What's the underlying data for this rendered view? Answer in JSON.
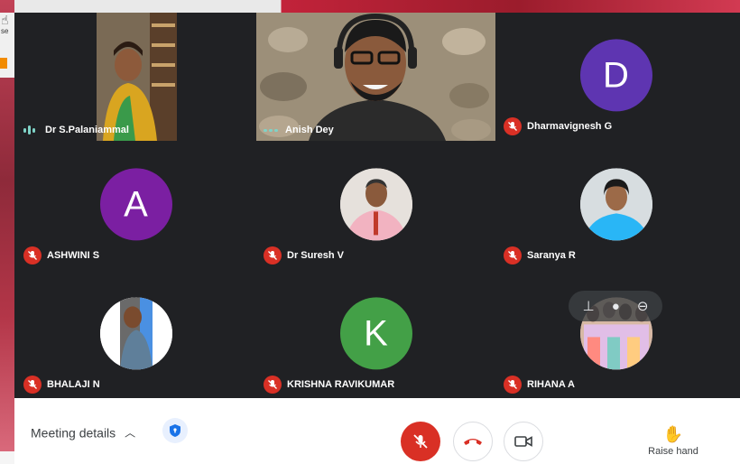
{
  "background": {
    "left_text": "se"
  },
  "participants": [
    {
      "name": "Dr S.Palaniammal",
      "state": "speaking",
      "media": "video"
    },
    {
      "name": "Anish Dey",
      "state": "speaking",
      "media": "video"
    },
    {
      "name": "Dharmavignesh G",
      "state": "muted",
      "media": "letter",
      "initial": "D",
      "color": "#5e35b1"
    },
    {
      "name": "ASHWINI S",
      "state": "muted",
      "media": "letter",
      "initial": "A",
      "color": "#7b1fa2"
    },
    {
      "name": "Dr Suresh V",
      "state": "muted",
      "media": "photo"
    },
    {
      "name": "Saranya R",
      "state": "muted",
      "media": "photo"
    },
    {
      "name": "BHALAJI N",
      "state": "muted",
      "media": "photo"
    },
    {
      "name": "KRISHNA RAVIKUMAR",
      "state": "muted",
      "media": "letter",
      "initial": "K",
      "color": "#43a047"
    },
    {
      "name": "RIHANA A",
      "state": "muted",
      "media": "photo"
    }
  ],
  "bottom_bar": {
    "meeting_details_label": "Meeting details",
    "raise_hand_label": "Raise hand"
  },
  "colors": {
    "accent_red": "#d93025",
    "tile_bg": "#3c4043",
    "window_bg": "#202124",
    "speaking_teal": "#7fd3c7"
  }
}
